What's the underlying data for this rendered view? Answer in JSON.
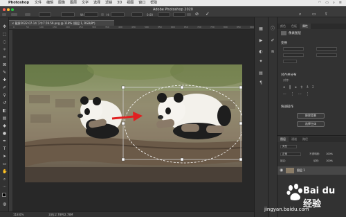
{
  "menubar": {
    "app_name": "Photoshop",
    "menus": [
      "文件",
      "编辑",
      "图像",
      "图层",
      "文字",
      "选择",
      "滤镜",
      "3D",
      "视图",
      "窗口",
      "帮助"
    ]
  },
  "window": {
    "title": "Adobe Photoshop 2020",
    "doc_tab": "截屏2022-07-14 下午7.59.59.png @ 118% (图层 1, RGB/8*)"
  },
  "options": {
    "width_label": "W:",
    "height_label": "H:",
    "angle_label": "0.00",
    "link_icon": "link-icon",
    "cancel_icon": "cancel-icon",
    "commit_icon": "check-icon"
  },
  "rulers": {
    "h_ticks": [
      "0",
      "50",
      "100",
      "150",
      "200",
      "250",
      "300",
      "350",
      "400",
      "450",
      "500",
      "550",
      "600",
      "650",
      "700",
      "750",
      "800",
      "850",
      "900"
    ]
  },
  "statusbar": {
    "zoom": "118.6%",
    "doc_info": "文档:2.78M/2.78M"
  },
  "panel": {
    "tabs": [
      "颜色",
      "色板",
      "属性"
    ],
    "header": "像素图层",
    "transform_label": "变换",
    "align_label": "对齐并分布",
    "align_sub": "对齐:",
    "quick_actions_label": "快速操作",
    "btn_remove_bg": "移除背景",
    "btn_select_subject": "选择主体",
    "layers_tabs": [
      "图层",
      "通道",
      "路径"
    ],
    "blend_mode": "正常",
    "opacity_label": "不透明度:",
    "opacity_value": "100%",
    "lock_label": "锁定:",
    "fill_label": "填充:",
    "fill_value": "100%",
    "layer_name": "图层 1",
    "search_placeholder": "类型"
  },
  "watermark": {
    "brand": "Bai du 经验",
    "url": "jingyan.baidu.com"
  }
}
